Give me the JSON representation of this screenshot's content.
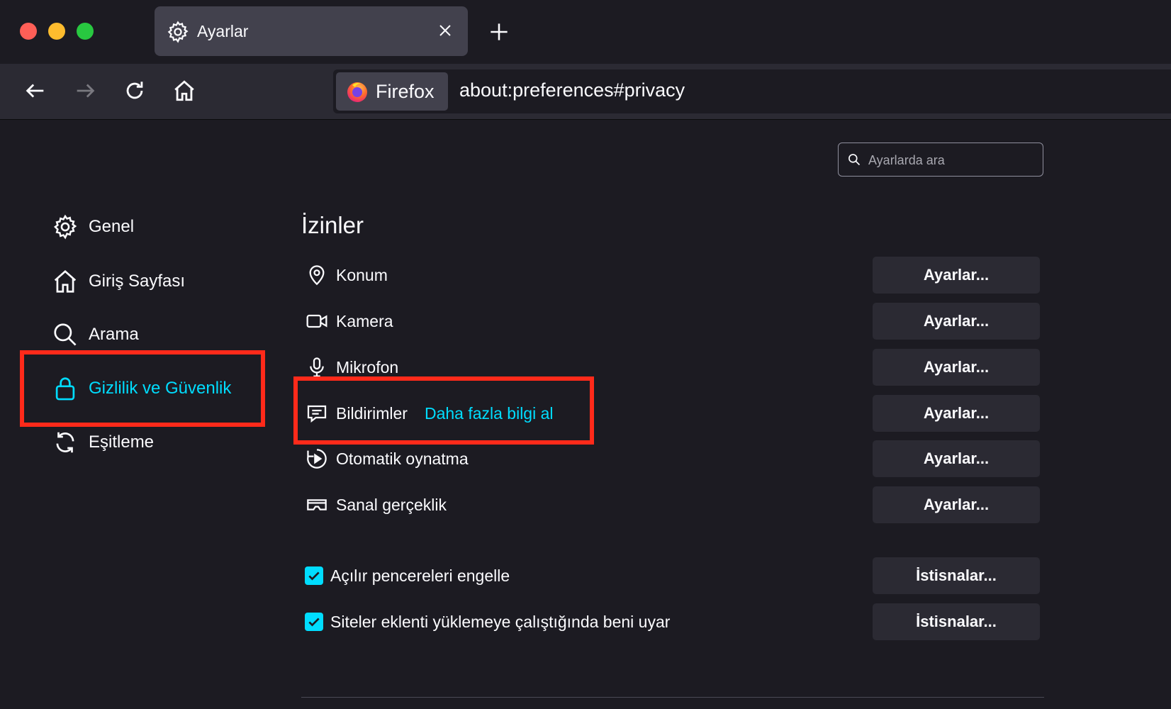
{
  "window": {
    "tab_title": "Ayarlar",
    "identity_label": "Firefox",
    "url": "about:preferences#privacy"
  },
  "search": {
    "placeholder": "Ayarlarda ara"
  },
  "sidebar": {
    "items": [
      {
        "label": "Genel",
        "icon": "gear-icon"
      },
      {
        "label": "Giriş Sayfası",
        "icon": "home-icon"
      },
      {
        "label": "Arama",
        "icon": "search-icon"
      },
      {
        "label": "Gizlilik ve Güvenlik",
        "icon": "lock-icon",
        "selected": true
      },
      {
        "label": "Eşitleme",
        "icon": "sync-icon"
      }
    ]
  },
  "permissions": {
    "title": "İzinler",
    "rows": [
      {
        "label": "Konum",
        "icon": "location-icon",
        "button": "Ayarlar..."
      },
      {
        "label": "Kamera",
        "icon": "camera-icon",
        "button": "Ayarlar..."
      },
      {
        "label": "Mikrofon",
        "icon": "microphone-icon",
        "button": "Ayarlar..."
      },
      {
        "label": "Bildirimler",
        "icon": "notification-icon",
        "link": "Daha fazla bilgi al",
        "button": "Ayarlar..."
      },
      {
        "label": "Otomatik oynatma",
        "icon": "autoplay-icon",
        "button": "Ayarlar..."
      },
      {
        "label": "Sanal gerçeklik",
        "icon": "vr-icon",
        "button": "Ayarlar..."
      }
    ],
    "checkboxes": [
      {
        "label": "Açılır pencereleri engelle",
        "checked": true,
        "button": "İstisnalar..."
      },
      {
        "label": "Siteler eklenti yüklemeye çalıştığında beni uyar",
        "checked": true,
        "button": "İstisnalar..."
      }
    ]
  },
  "colors": {
    "accent": "#00ddff",
    "highlight": "#ff2a1a",
    "background": "#1c1b22",
    "button": "#2b2a33"
  }
}
